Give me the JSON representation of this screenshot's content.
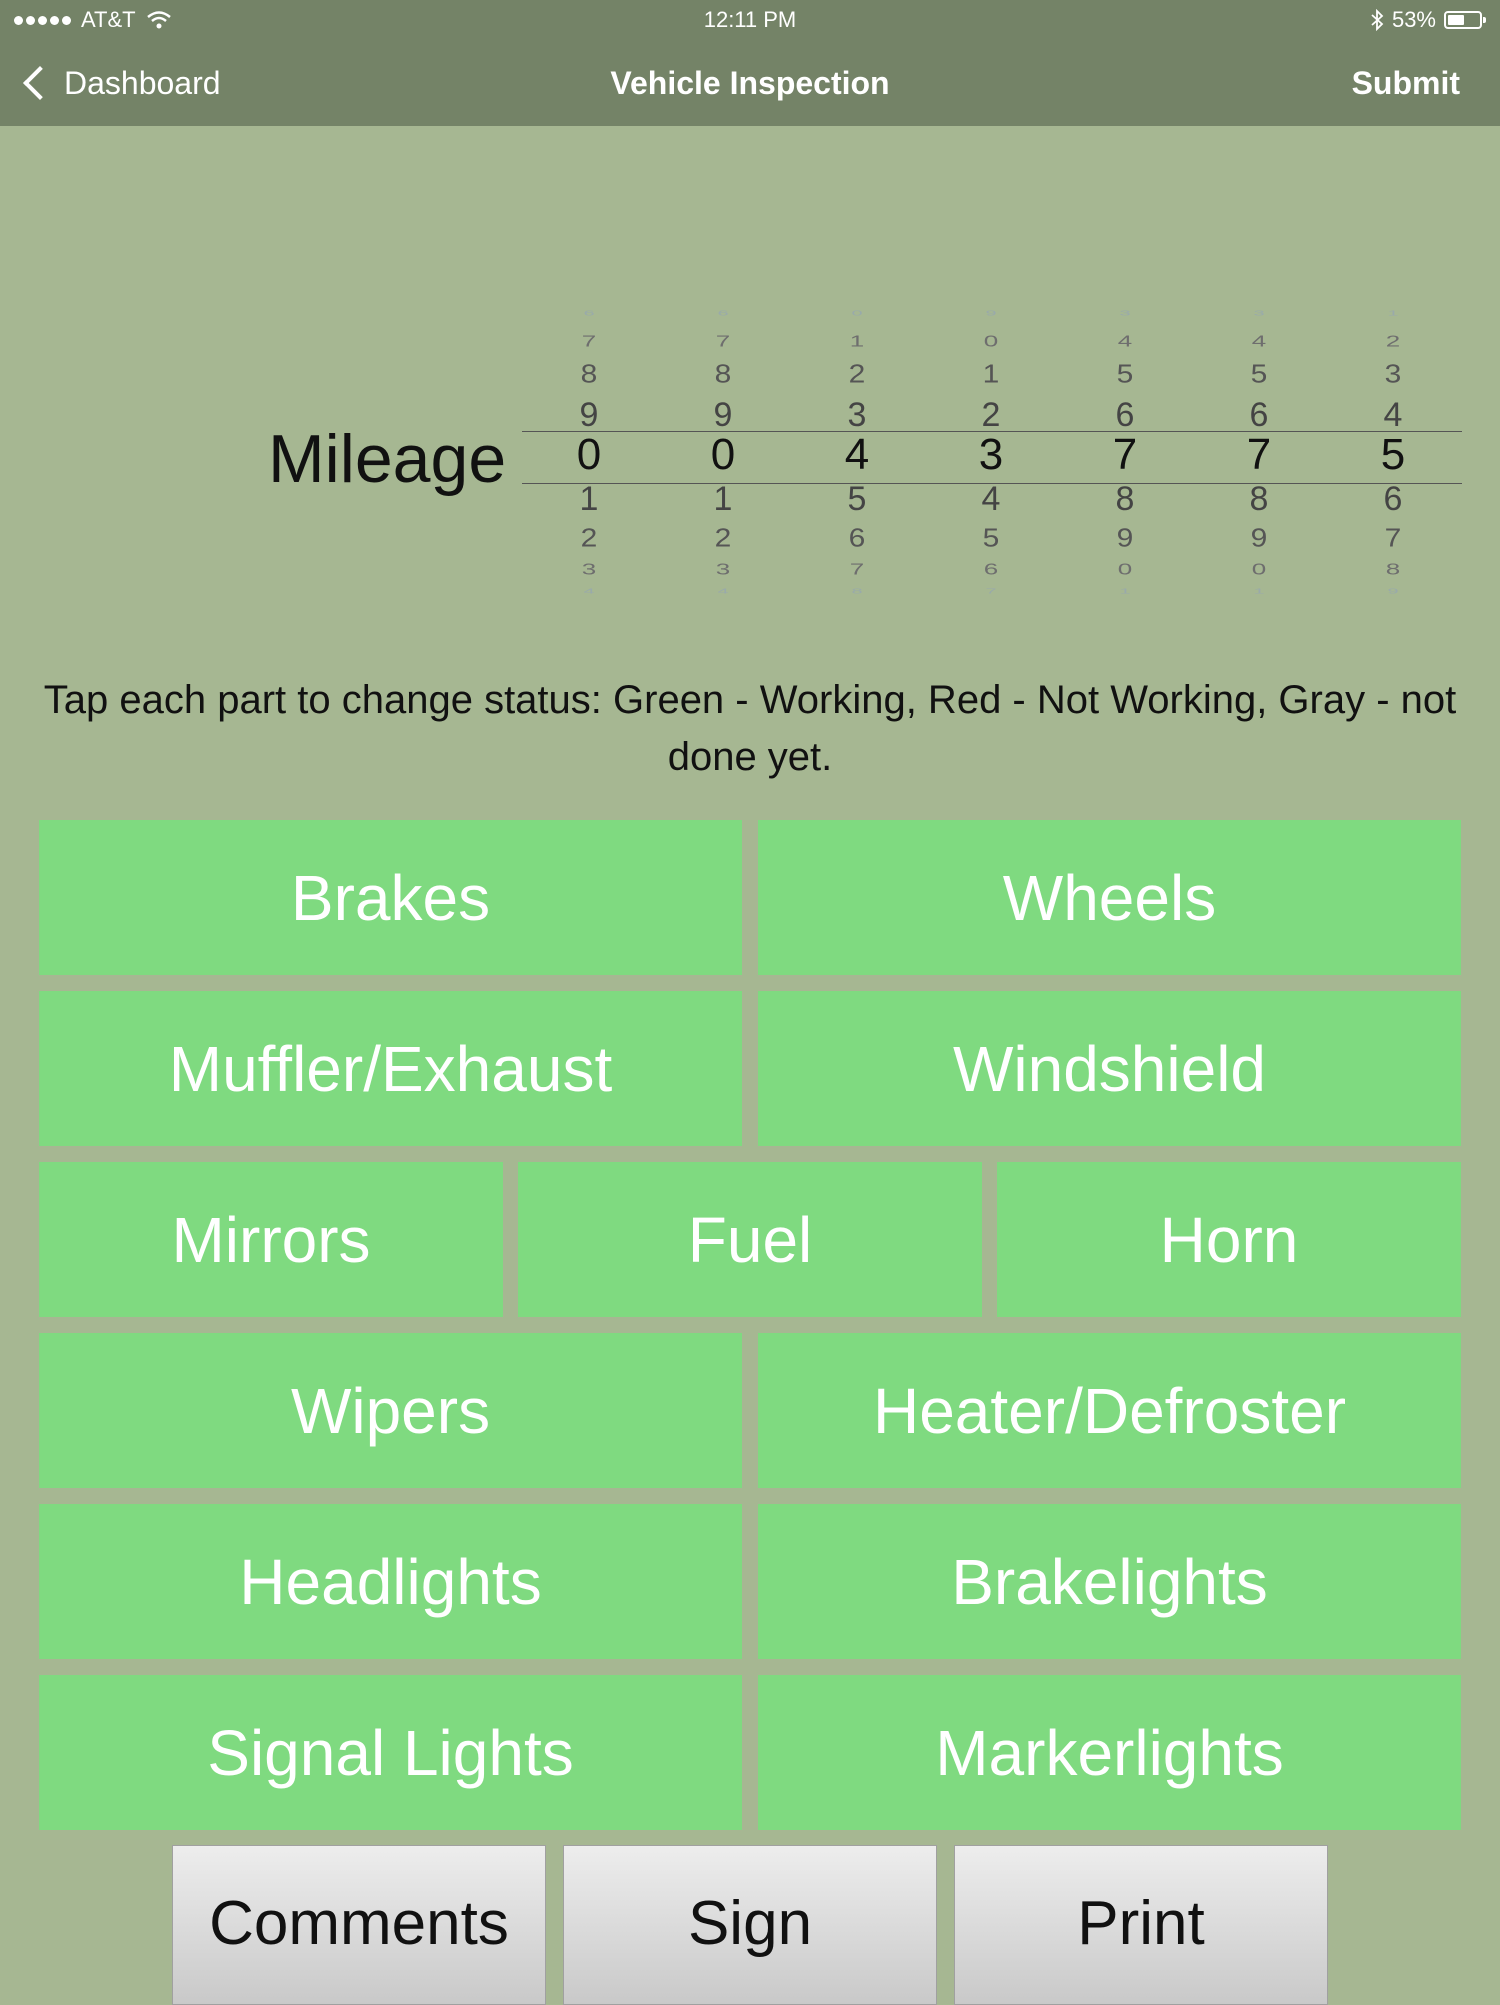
{
  "status_bar": {
    "carrier": "AT&T",
    "time": "12:11 PM",
    "battery": "53%"
  },
  "nav": {
    "back_label": "Dashboard",
    "title": "Vehicle Inspection",
    "submit_label": "Submit"
  },
  "mileage": {
    "label": "Mileage",
    "value": "0043775",
    "wheels": [
      {
        "above": [
          "6",
          "7",
          "8",
          "9"
        ],
        "selected": "0",
        "below": [
          "1",
          "2",
          "3",
          "4"
        ]
      },
      {
        "above": [
          "6",
          "7",
          "8",
          "9"
        ],
        "selected": "0",
        "below": [
          "1",
          "2",
          "3",
          "4"
        ]
      },
      {
        "above": [
          "0",
          "1",
          "2",
          "3"
        ],
        "selected": "4",
        "below": [
          "5",
          "6",
          "7",
          "8"
        ]
      },
      {
        "above": [
          "9",
          "0",
          "1",
          "2"
        ],
        "selected": "3",
        "below": [
          "4",
          "5",
          "6",
          "7"
        ]
      },
      {
        "above": [
          "3",
          "4",
          "5",
          "6"
        ],
        "selected": "7",
        "below": [
          "8",
          "9",
          "0",
          "1"
        ]
      },
      {
        "above": [
          "3",
          "4",
          "5",
          "6"
        ],
        "selected": "7",
        "below": [
          "8",
          "9",
          "0",
          "1"
        ]
      },
      {
        "above": [
          "1",
          "2",
          "3",
          "4"
        ],
        "selected": "5",
        "below": [
          "6",
          "7",
          "8",
          "9"
        ]
      }
    ]
  },
  "instructions": "Tap each part to change status: Green - Working, Red - Not Working, Gray - not done yet.",
  "parts": {
    "brakes": "Brakes",
    "wheels": "Wheels",
    "muffler": "Muffler/Exhaust",
    "windshield": "Windshield",
    "mirrors": "Mirrors",
    "fuel": "Fuel",
    "horn": "Horn",
    "wipers": "Wipers",
    "heater": "Heater/Defroster",
    "headlights": "Headlights",
    "brakelights": "Brakelights",
    "signal": "Signal Lights",
    "markerlights": "Markerlights"
  },
  "part_status_color": "#7fda80",
  "buttons": {
    "comments": "Comments",
    "sign": "Sign",
    "print": "Print"
  }
}
